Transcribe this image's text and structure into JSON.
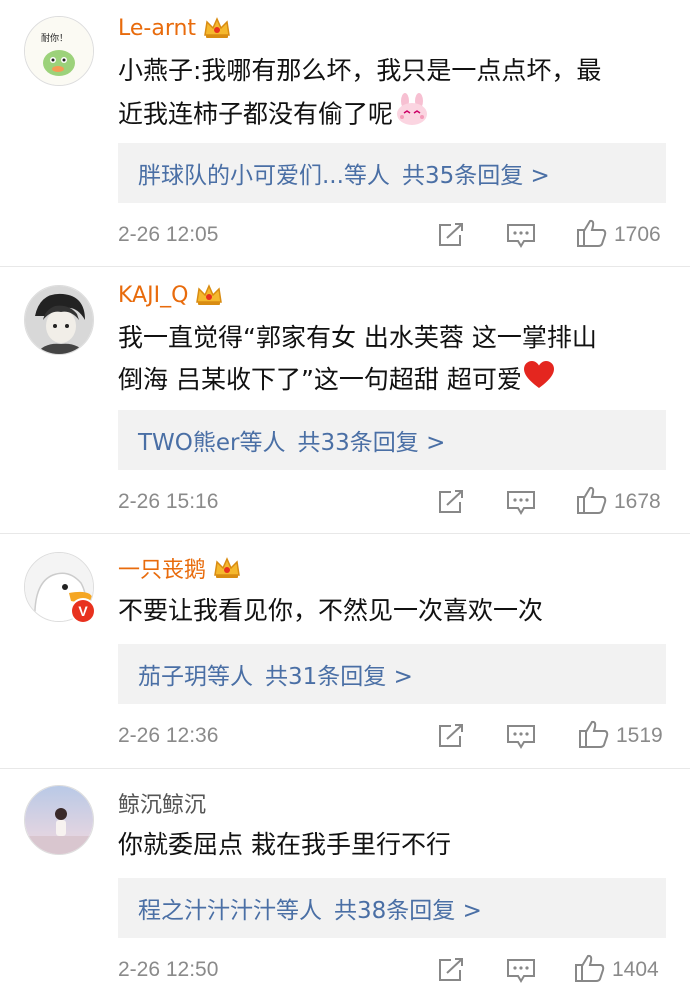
{
  "comments": [
    {
      "username": "Le-arnt",
      "text_line1": "小燕子:我哪有那么坏，我只是一点点坏，最",
      "text_line2": "近我连柿子都没有偷了呢",
      "emoji": "pink-bunny-emoji",
      "reply_users": "胖球队的小可爱们...等人",
      "reply_count": "共35条回复 >",
      "timestamp": "2-26 12:05",
      "likes": "1706"
    },
    {
      "username": "KAJI_Q",
      "text_line1": "我一直觉得“郭家有女 出水芙蓉 这一掌排山",
      "text_line2": "倒海 吕某收下了”这一句超甜 超可爱",
      "emoji": "red-heart-emoji",
      "reply_users": "TWO熊er等人",
      "reply_count": "共33条回复 >",
      "timestamp": "2-26 15:16",
      "likes": "1678"
    },
    {
      "username": "一只丧鹅",
      "text_line1": "不要让我看见你，不然见一次喜欢一次",
      "avatar_badge": "V",
      "reply_users": "茄子玥等人",
      "reply_count": "共31条回复 >",
      "timestamp": "2-26 12:36",
      "likes": "1519"
    },
    {
      "username": "鲸沉鲸沉",
      "text_line1": "你就委屈点 栽在我手里行不行",
      "reply_users": "程之汁汁汁汁等人",
      "reply_count": "共38条回复 >",
      "timestamp": "2-26 12:50",
      "likes": "1404"
    }
  ],
  "avatar1_text": "耐你！",
  "colors": {
    "username": "#e86b0c",
    "link": "#4a6fa5",
    "meta": "#8a8a8a",
    "reply_bg": "#f2f2f2"
  },
  "icons": [
    "crown-icon",
    "share-icon",
    "comment-icon",
    "like-icon"
  ]
}
